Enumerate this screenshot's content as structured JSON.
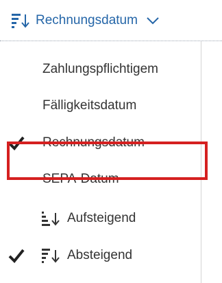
{
  "sort": {
    "current_label": "Rechnungsdatum",
    "sort_icon": "sort-descending-icon",
    "chevron_icon": "chevron-down-icon"
  },
  "menu": {
    "fields": [
      {
        "label": "Zahlungspflichtigem",
        "checked": false
      },
      {
        "label": "Fälligkeitsdatum",
        "checked": false
      },
      {
        "label": "Rechnungsdatum",
        "checked": true
      },
      {
        "label": "SEPA-Datum",
        "checked": false,
        "highlighted": true
      }
    ],
    "order": [
      {
        "label": "Aufsteigend",
        "icon": "sort-ascending-icon",
        "checked": false
      },
      {
        "label": "Absteigend",
        "icon": "sort-descending-icon",
        "checked": true
      }
    ]
  },
  "colors": {
    "accent": "#2566a8",
    "text": "#333333",
    "highlight_border": "#d52020",
    "check": "#222222"
  }
}
